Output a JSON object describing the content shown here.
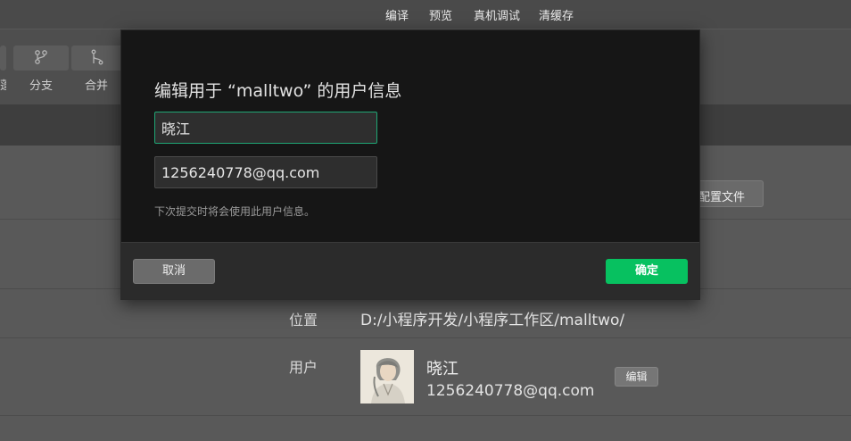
{
  "top_menu": {
    "compile": "编译",
    "preview": "预览",
    "device_debug": "真机调试",
    "clear_cache": "清缓存"
  },
  "toolbar": {
    "partial_label": "蓬",
    "branch": {
      "label": "分支",
      "icon": "branch-icon"
    },
    "merge": {
      "label": "合并",
      "icon": "merge-icon"
    }
  },
  "background_panel": {
    "config_button_partial": "配置文件",
    "location_label": "位置",
    "location_value": "D:/小程序开发/小程序工作区/malltwo/",
    "user_label": "用户",
    "user_name": "晓江",
    "user_email": "1256240778@qq.com",
    "edit_button": "编辑"
  },
  "dialog": {
    "title": "编辑用于 “malltwo” 的用户信息",
    "name_value": "晓江",
    "email_value": "1256240778@qq.com",
    "hint": "下次提交时将会使用此用户信息。",
    "cancel_label": "取消",
    "confirm_label": "确定"
  },
  "colors": {
    "accent_green": "#07c160",
    "focus_border": "#1fa775",
    "dialog_bg": "#161616",
    "page_bg": "#595959"
  }
}
